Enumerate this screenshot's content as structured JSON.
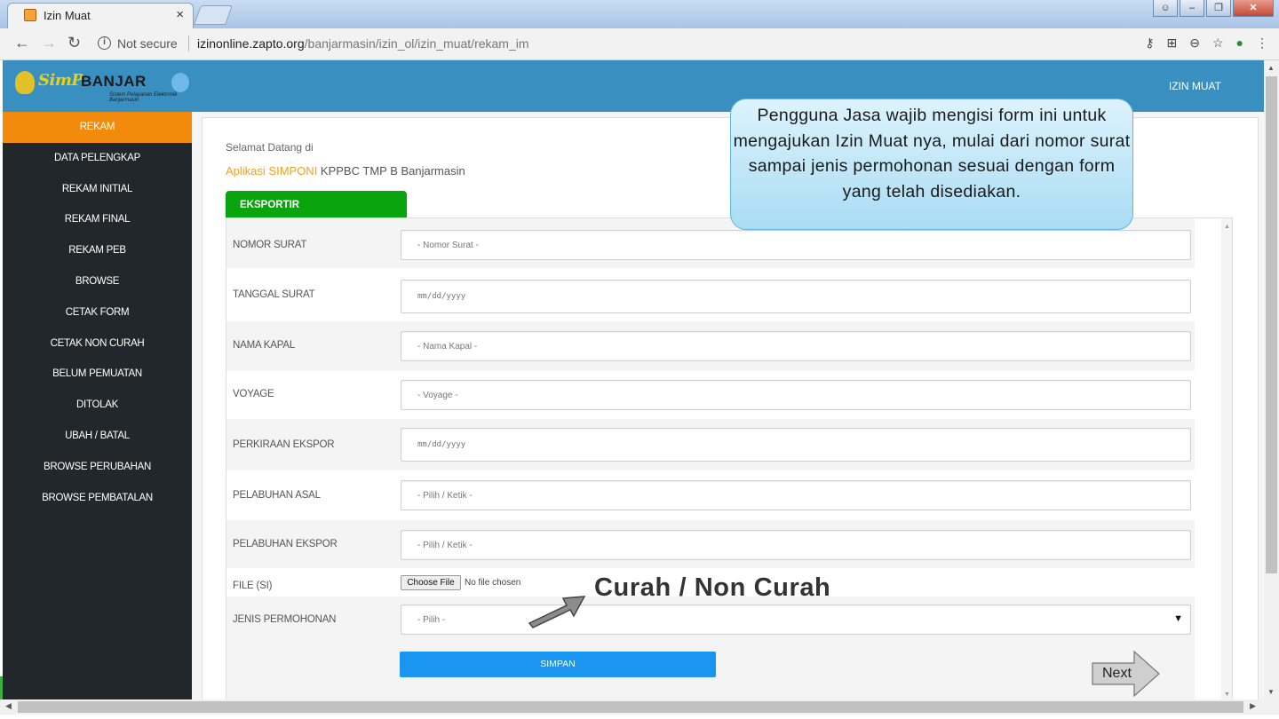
{
  "browser": {
    "tab_title": "Izin Muat",
    "close_glyph": "×",
    "security": "Not secure",
    "url_host": "izinonline.zapto.org",
    "url_path": "/banjarmasin/izin_ol/izin_muat/rekam_im",
    "icons": [
      "key-icon",
      "translate-icon",
      "zoom-icon",
      "star-icon",
      "extension-icon",
      "menu-icon"
    ]
  },
  "header": {
    "brand": "SimP",
    "brand_suffix": "BANJAR",
    "tagline": "Sistem Pelayanan Elektronik Banjarmasin",
    "right_label": "IZIN MUAT",
    "color": "#3a8fc1"
  },
  "sidebar": {
    "items": [
      {
        "label": "REKAM",
        "active": true
      },
      {
        "label": "DATA PELENGKAP"
      },
      {
        "label": "REKAM INITIAL"
      },
      {
        "label": "REKAM FINAL"
      },
      {
        "label": "REKAM PEB"
      },
      {
        "label": "BROWSE"
      },
      {
        "label": "CETAK FORM"
      },
      {
        "label": "CETAK NON CURAH"
      },
      {
        "label": "BELUM PEMUATAN"
      },
      {
        "label": "DITOLAK"
      },
      {
        "label": "UBAH / BATAL"
      },
      {
        "label": "BROWSE PERUBAHAN"
      },
      {
        "label": "BROWSE PEMBATALAN"
      }
    ]
  },
  "main": {
    "welcome": "Selamat Datang di",
    "app_highlight": "Aplikasi SIMPONI",
    "app_rest": " KPPBC TMP B Banjarmasin",
    "tab_label": "EKSPORTIR",
    "fields": [
      {
        "label": "NOMOR SURAT",
        "placeholder": "- Nomor Surat -"
      },
      {
        "label": "TANGGAL SURAT",
        "placeholder": "mm/dd/yyyy"
      },
      {
        "label": "NAMA KAPAL",
        "placeholder": "- Nama Kapal -"
      },
      {
        "label": "VOYAGE",
        "placeholder": "- Voyage -"
      },
      {
        "label": "PERKIRAAN EKSPOR",
        "placeholder": "mm/dd/yyyy"
      },
      {
        "label": "PELABUHAN ASAL",
        "placeholder": "- Pilih / Ketik -"
      },
      {
        "label": "PELABUHAN EKSPOR",
        "placeholder": "- Pilih / Ketik -"
      }
    ],
    "file_label": "FILE (SI)",
    "file_button": "Choose File",
    "file_status": "No file chosen",
    "jenis_label": "JENIS PERMOHONAN",
    "jenis_value": "- Pilih -",
    "save_label": "SIMPAN"
  },
  "annotations": {
    "callout": "Pengguna Jasa wajib mengisi form ini untuk mengajukan Izin Muat nya, mulai dari nomor surat sampai jenis permohonan sesuai dengan form yang telah disediakan.",
    "curah_note": "Curah / Non Curah",
    "next_label": "Next"
  }
}
